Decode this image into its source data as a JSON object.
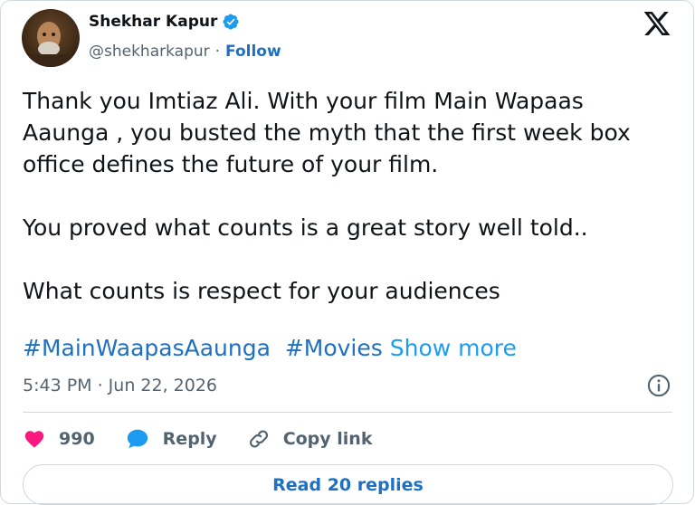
{
  "author": {
    "name": "Shekhar Kapur",
    "handle": "@shekharkapur",
    "separator": "·",
    "follow_label": "Follow"
  },
  "tweet": {
    "paragraphs": [
      "Thank you Imtiaz Ali. With your film Main Wapaas Aaunga , you busted the myth that the first week box office defines the future of your film.",
      "You proved what counts is a great story well told..",
      "What counts is respect for your audiences"
    ],
    "hashtags": [
      "#MainWaapasAaunga",
      "#Movies"
    ],
    "show_more_label": "Show more"
  },
  "timestamp": "5:43 PM · Jun 22, 2026",
  "actions": {
    "likes_count": "990",
    "reply_label": "Reply",
    "copy_link_label": "Copy link"
  },
  "read_replies_label": "Read 20 replies",
  "colors": {
    "link": "#1d70c2",
    "heart": "#f91880",
    "reply_bubble": "#1d9bf0",
    "verified": "#1d9bf0",
    "muted": "#536471"
  },
  "icons": [
    "verified-badge-icon",
    "x-logo-icon",
    "info-icon",
    "heart-icon",
    "reply-bubble-icon",
    "link-icon"
  ]
}
